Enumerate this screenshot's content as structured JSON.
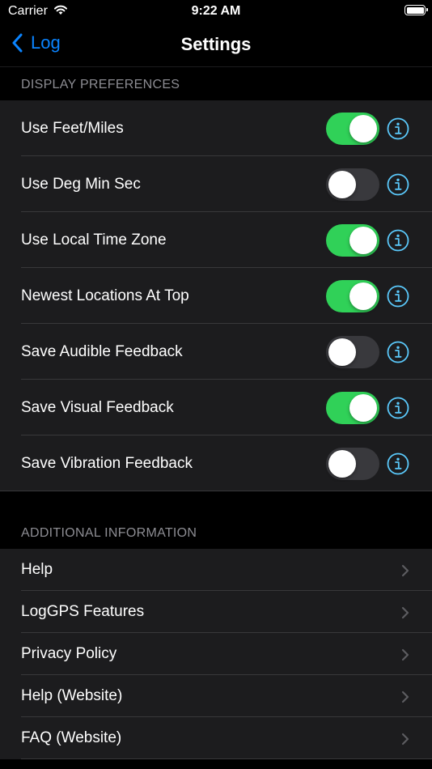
{
  "status_bar": {
    "carrier": "Carrier",
    "time": "9:22 AM"
  },
  "nav": {
    "back_label": "Log",
    "title": "Settings"
  },
  "display_preferences": {
    "header": "DISPLAY PREFERENCES",
    "items": [
      {
        "label": "Use Feet/Miles",
        "enabled": true
      },
      {
        "label": "Use Deg Min Sec",
        "enabled": false
      },
      {
        "label": "Use Local Time Zone",
        "enabled": true
      },
      {
        "label": "Newest Locations At Top",
        "enabled": true
      },
      {
        "label": "Save Audible Feedback",
        "enabled": false
      },
      {
        "label": "Save Visual Feedback",
        "enabled": true
      },
      {
        "label": "Save Vibration Feedback",
        "enabled": false
      }
    ]
  },
  "additional_information": {
    "header": "ADDITIONAL INFORMATION",
    "items": [
      {
        "label": "Help"
      },
      {
        "label": "LogGPS Features"
      },
      {
        "label": "Privacy Policy"
      },
      {
        "label": "Help (Website)"
      },
      {
        "label": "FAQ (Website)"
      }
    ]
  },
  "colors": {
    "accent": "#0a84ff",
    "toggle_on": "#30d158",
    "toggle_off": "#39393d",
    "info_icon": "#5ac8fa",
    "section_header": "#8d8d93",
    "cell_background": "#1c1c1e"
  },
  "icons": {
    "back": "chevron-left-icon",
    "info": "info-circle-icon",
    "disclosure": "chevron-right-icon",
    "wifi": "wifi-icon",
    "battery": "battery-icon"
  }
}
